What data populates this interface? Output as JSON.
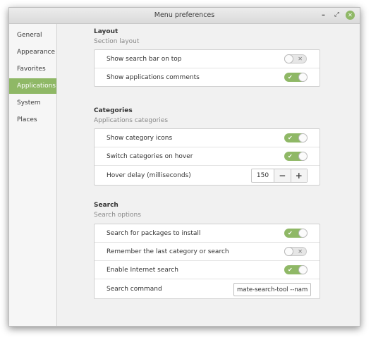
{
  "window": {
    "title": "Menu preferences",
    "minimize_glyph": "–",
    "maximize_glyph": "⤢",
    "close_glyph": "✕"
  },
  "sidebar": {
    "items": [
      {
        "label": "General"
      },
      {
        "label": "Appearance"
      },
      {
        "label": "Favorites"
      },
      {
        "label": "Applications"
      },
      {
        "label": "System"
      },
      {
        "label": "Places"
      }
    ],
    "selected": "Applications"
  },
  "sections": {
    "layout": {
      "title": "Layout",
      "subtitle": "Section layout",
      "rows": [
        {
          "label": "Show search bar on top",
          "state": "off"
        },
        {
          "label": "Show applications comments",
          "state": "on"
        }
      ]
    },
    "categories": {
      "title": "Categories",
      "subtitle": "Applications categories",
      "rows": [
        {
          "label": "Show category icons",
          "state": "on"
        },
        {
          "label": "Switch categories on hover",
          "state": "on"
        },
        {
          "label": "Hover delay (milliseconds)",
          "value": "150",
          "minus": "−",
          "plus": "+"
        }
      ]
    },
    "search": {
      "title": "Search",
      "subtitle": "Search options",
      "rows": [
        {
          "label": "Search for packages to install",
          "state": "on"
        },
        {
          "label": "Remember the last category or search",
          "state": "off"
        },
        {
          "label": "Enable Internet search",
          "state": "on"
        },
        {
          "label": "Search command",
          "value": "mate-search-tool --named"
        }
      ]
    }
  },
  "toggle_glyphs": {
    "on": "✔",
    "off": "✕"
  },
  "colors": {
    "accent": "#8fb866",
    "toggle_off": "#e6e6e6"
  }
}
